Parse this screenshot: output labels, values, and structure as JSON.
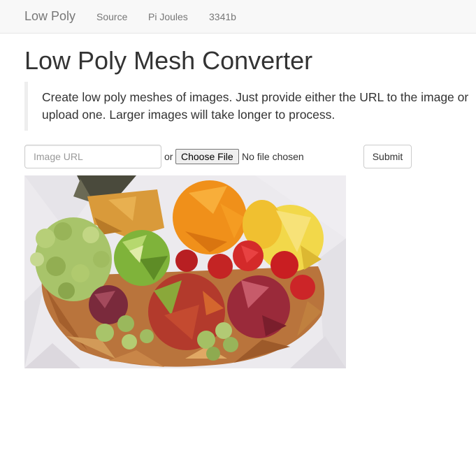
{
  "navbar": {
    "brand": "Low Poly",
    "links": [
      "Source",
      "Pi Joules",
      "3341b"
    ]
  },
  "main": {
    "title": "Low Poly Mesh Converter",
    "description": "Create low poly meshes of images. Just provide either the URL to the image or upload one. Larger images will take longer to process."
  },
  "form": {
    "url_placeholder": "Image URL",
    "or_text": "or",
    "choose_file_label": "Choose File",
    "file_status": "No file chosen",
    "submit_label": "Submit"
  },
  "preview": {
    "subject": "low poly fruit basket",
    "colors": {
      "background": "#eceaee",
      "basket": "#b9743c",
      "orange": "#f0901a",
      "lemon": "#f2d84a",
      "grapes": "#a8c46a",
      "apple_green": "#7fb33a",
      "strawberry": "#d42a2a",
      "red_apple": "#9a2a3a",
      "pineapple": "#d99a3a"
    }
  }
}
